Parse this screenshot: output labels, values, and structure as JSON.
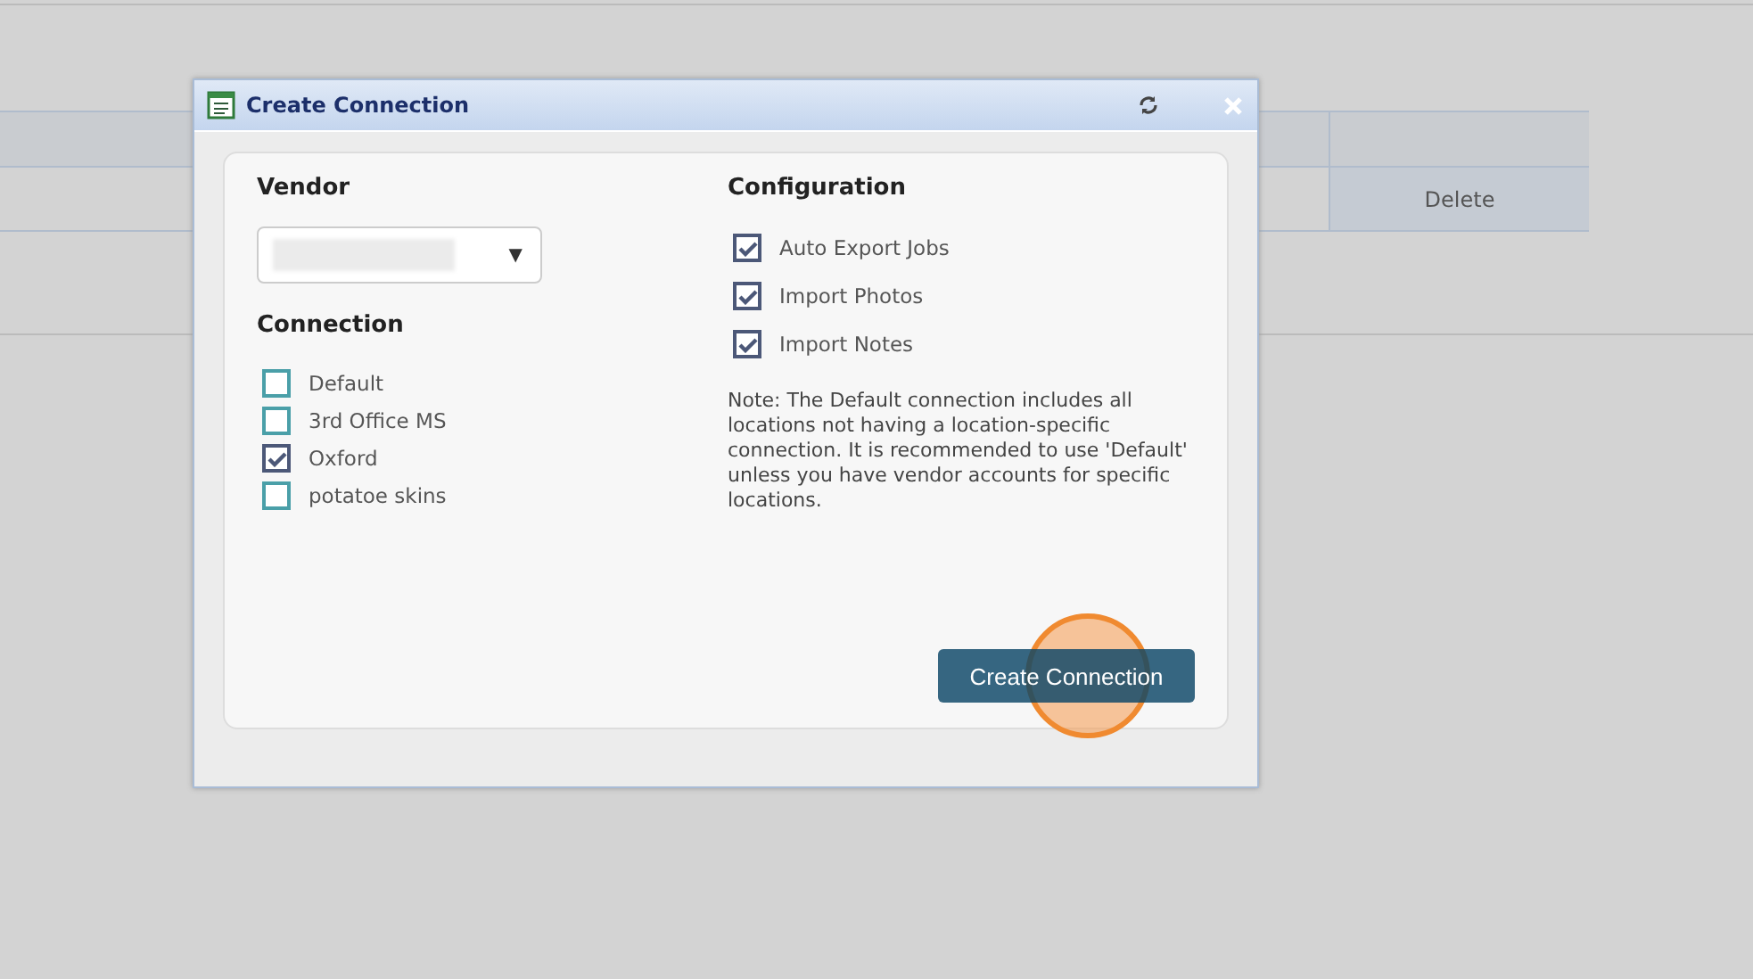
{
  "background_table": {
    "action": "Delete"
  },
  "dialog": {
    "title": "Create Connection",
    "vendor": {
      "label": "Vendor",
      "arrow": "▼"
    },
    "connection": {
      "label": "Connection",
      "items": [
        {
          "label": "Default",
          "checked": false
        },
        {
          "label": "3rd Office MS",
          "checked": false
        },
        {
          "label": "Oxford",
          "checked": true
        },
        {
          "label": "potatoe skins",
          "checked": false
        }
      ]
    },
    "configuration": {
      "label": "Configuration",
      "items": [
        {
          "label": "Auto Export Jobs",
          "checked": true
        },
        {
          "label": "Import Photos",
          "checked": true
        },
        {
          "label": "Import Notes",
          "checked": true
        }
      ]
    },
    "note": "Note: The Default connection includes all locations not having a location-specific connection. It is recommended to use 'Default' unless you have vendor accounts for specific locations.",
    "submit": "Create Connection"
  }
}
